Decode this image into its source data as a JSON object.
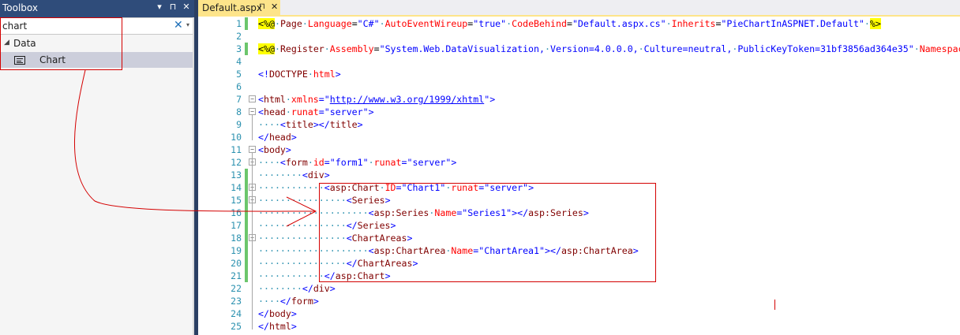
{
  "toolbox": {
    "title": "Toolbox",
    "buttons": [
      "▾",
      "⊓",
      "✕"
    ],
    "search_value": "chart",
    "clear_icon": "✕",
    "dropdown_icon": "▾",
    "group": "Data",
    "item": "Chart"
  },
  "tab": {
    "title": "Default.aspx",
    "pin": "⊓",
    "close": "✕"
  },
  "line_numbers": [
    "1",
    "2",
    "3",
    "4",
    "5",
    "6",
    "7",
    "8",
    "9",
    "10",
    "11",
    "12",
    "13",
    "14",
    "15",
    "16",
    "17",
    "18",
    "19",
    "20",
    "21",
    "22",
    "23",
    "24",
    "25"
  ],
  "code": {
    "l1": [
      [
        "hl",
        "<%@"
      ],
      [
        "ws",
        "·"
      ],
      [
        "tg",
        "Page"
      ],
      [
        "ws",
        "·"
      ],
      [
        "at",
        "Language"
      ],
      [
        "bk",
        "="
      ],
      [
        "st",
        "\"C#\""
      ],
      [
        "ws",
        "·"
      ],
      [
        "at",
        "AutoEventWireup"
      ],
      [
        "bk",
        "="
      ],
      [
        "st",
        "\"true\""
      ],
      [
        "ws",
        "·"
      ],
      [
        "at",
        "CodeBehind"
      ],
      [
        "bk",
        "="
      ],
      [
        "st",
        "\"Default.aspx.cs\""
      ],
      [
        "ws",
        "·"
      ],
      [
        "at",
        "Inherits"
      ],
      [
        "bk",
        "="
      ],
      [
        "st",
        "\"PieChartInASPNET.Default\""
      ],
      [
        "ws",
        "·"
      ],
      [
        "hl",
        "%>"
      ]
    ],
    "l3": [
      [
        "hl",
        "<%@"
      ],
      [
        "ws",
        "·"
      ],
      [
        "tg",
        "Register"
      ],
      [
        "ws",
        "·"
      ],
      [
        "at",
        "Assembly"
      ],
      [
        "bk",
        "="
      ],
      [
        "st",
        "\"System.Web.DataVisualization,"
      ],
      [
        "ws",
        "·"
      ],
      [
        "st",
        "Version=4.0.0.0,"
      ],
      [
        "ws",
        "·"
      ],
      [
        "st",
        "Culture=neutral,"
      ],
      [
        "ws",
        "·"
      ],
      [
        "st",
        "PublicKeyToken=31bf3856ad364e35\""
      ],
      [
        "ws",
        "·"
      ],
      [
        "at",
        "Namespace"
      ]
    ],
    "l5": [
      [
        "st",
        "<!"
      ],
      [
        "tg",
        "DOCTYPE"
      ],
      [
        "ws",
        "·"
      ],
      [
        "at",
        "html"
      ],
      [
        "st",
        ">"
      ]
    ],
    "l7": [
      [
        "st",
        "<"
      ],
      [
        "tg",
        "html"
      ],
      [
        "ws",
        "·"
      ],
      [
        "at",
        "xmlns"
      ],
      [
        "st",
        "=\""
      ],
      [
        "ul",
        "http://www.w3.org/1999/xhtml"
      ],
      [
        "st",
        "\">"
      ]
    ],
    "l8": [
      [
        "st",
        "<"
      ],
      [
        "tg",
        "head"
      ],
      [
        "ws",
        "·"
      ],
      [
        "at",
        "runat"
      ],
      [
        "st",
        "=\"server\">"
      ]
    ],
    "l9": [
      [
        "ws",
        "····"
      ],
      [
        "st",
        "<"
      ],
      [
        "tg",
        "title"
      ],
      [
        "st",
        "></"
      ],
      [
        "tg",
        "title"
      ],
      [
        "st",
        ">"
      ]
    ],
    "l10": [
      [
        "st",
        "</"
      ],
      [
        "tg",
        "head"
      ],
      [
        "st",
        ">"
      ]
    ],
    "l11": [
      [
        "st",
        "<"
      ],
      [
        "tg",
        "body"
      ],
      [
        "st",
        ">"
      ]
    ],
    "l12": [
      [
        "ws",
        "····"
      ],
      [
        "st",
        "<"
      ],
      [
        "tg",
        "form"
      ],
      [
        "ws",
        "·"
      ],
      [
        "at",
        "id"
      ],
      [
        "st",
        "=\"form1\""
      ],
      [
        "ws",
        "·"
      ],
      [
        "at",
        "runat"
      ],
      [
        "st",
        "=\"server\">"
      ]
    ],
    "l13": [
      [
        "ws",
        "········"
      ],
      [
        "st",
        "<"
      ],
      [
        "tg",
        "div"
      ],
      [
        "st",
        ">"
      ]
    ],
    "l14": [
      [
        "ws",
        "············"
      ],
      [
        "st",
        "<"
      ],
      [
        "tg",
        "asp:Chart"
      ],
      [
        "ws",
        "·"
      ],
      [
        "at",
        "ID"
      ],
      [
        "st",
        "=\"Chart1\""
      ],
      [
        "ws",
        "·"
      ],
      [
        "at",
        "runat"
      ],
      [
        "st",
        "=\"server\">"
      ]
    ],
    "l15": [
      [
        "ws",
        "················"
      ],
      [
        "st",
        "<"
      ],
      [
        "tg",
        "Series"
      ],
      [
        "st",
        ">"
      ]
    ],
    "l16": [
      [
        "ws",
        "····················"
      ],
      [
        "st",
        "<"
      ],
      [
        "tg",
        "asp:Series"
      ],
      [
        "ws",
        "·"
      ],
      [
        "at",
        "Name"
      ],
      [
        "st",
        "=\"Series1\"></"
      ],
      [
        "tg",
        "asp:Series"
      ],
      [
        "st",
        ">"
      ]
    ],
    "l17": [
      [
        "ws",
        "················"
      ],
      [
        "st",
        "</"
      ],
      [
        "tg",
        "Series"
      ],
      [
        "st",
        ">"
      ]
    ],
    "l18": [
      [
        "ws",
        "················"
      ],
      [
        "st",
        "<"
      ],
      [
        "tg",
        "ChartAreas"
      ],
      [
        "st",
        ">"
      ]
    ],
    "l19": [
      [
        "ws",
        "····················"
      ],
      [
        "st",
        "<"
      ],
      [
        "tg",
        "asp:ChartArea"
      ],
      [
        "ws",
        "·"
      ],
      [
        "at",
        "Name"
      ],
      [
        "st",
        "=\"ChartArea1\"></"
      ],
      [
        "tg",
        "asp:ChartArea"
      ],
      [
        "st",
        ">"
      ]
    ],
    "l20": [
      [
        "ws",
        "················"
      ],
      [
        "st",
        "</"
      ],
      [
        "tg",
        "ChartAreas"
      ],
      [
        "st",
        ">"
      ]
    ],
    "l21": [
      [
        "ws",
        "············"
      ],
      [
        "st",
        "</"
      ],
      [
        "tg",
        "asp:Chart"
      ],
      [
        "st",
        ">"
      ]
    ],
    "l22": [
      [
        "ws",
        "········"
      ],
      [
        "st",
        "</"
      ],
      [
        "tg",
        "div"
      ],
      [
        "st",
        ">"
      ]
    ],
    "l23": [
      [
        "ws",
        "····"
      ],
      [
        "st",
        "</"
      ],
      [
        "tg",
        "form"
      ],
      [
        "st",
        ">"
      ]
    ],
    "l24": [
      [
        "st",
        "</"
      ],
      [
        "tg",
        "body"
      ],
      [
        "st",
        ">"
      ]
    ],
    "l25": [
      [
        "st",
        "</"
      ],
      [
        "tg",
        "html"
      ],
      [
        "st",
        ">"
      ]
    ]
  }
}
